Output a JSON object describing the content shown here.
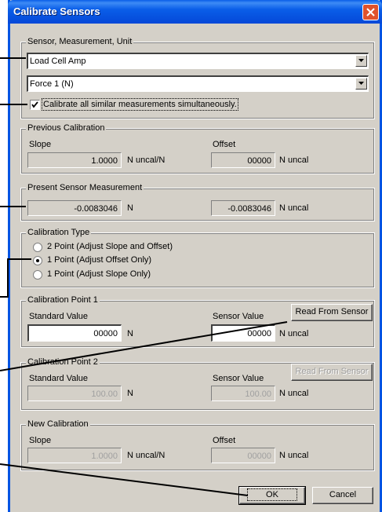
{
  "window": {
    "title": "Calibrate Sensors"
  },
  "sensor_group": {
    "label": "Sensor, Measurement, Unit",
    "sensor_value": "Load Cell Amp",
    "measurement_value": "Force 1 (N)",
    "checkbox_label": "Calibrate all similar measurements simultaneously.",
    "checkbox_checked": true
  },
  "previous": {
    "label": "Previous Calibration",
    "slope_label": "Slope",
    "slope_value": "1.0000",
    "slope_unit": "N uncal/N",
    "offset_label": "Offset",
    "offset_value": "00000",
    "offset_unit": "N uncal"
  },
  "present": {
    "label": "Present Sensor Measurement",
    "value1": "-0.0083046",
    "unit1": "N",
    "value2": "-0.0083046",
    "unit2": "N uncal"
  },
  "cal_type": {
    "label": "Calibration Type",
    "options": [
      {
        "label": "2 Point (Adjust Slope and Offset)",
        "selected": false
      },
      {
        "label": "1 Point (Adjust Offset Only)",
        "selected": true
      },
      {
        "label": "1 Point (Adjust Slope Only)",
        "selected": false
      }
    ]
  },
  "point1": {
    "label": "Calibration Point 1",
    "standard_label": "Standard Value",
    "standard_value": "00000",
    "standard_unit": "N",
    "sensor_label": "Sensor Value",
    "sensor_value": "00000",
    "sensor_unit": "N uncal",
    "read_button": "Read From Sensor"
  },
  "point2": {
    "label": "Calibration Point 2",
    "standard_label": "Standard Value",
    "standard_value": "100.00",
    "standard_unit": "N",
    "sensor_label": "Sensor Value",
    "sensor_value": "100.00",
    "sensor_unit": "N uncal",
    "read_button": "Read From Sensor"
  },
  "new_cal": {
    "label": "New Calibration",
    "slope_label": "Slope",
    "slope_value": "1.0000",
    "slope_unit": "N uncal/N",
    "offset_label": "Offset",
    "offset_value": "00000",
    "offset_unit": "N uncal"
  },
  "buttons": {
    "ok": "OK",
    "cancel": "Cancel"
  }
}
